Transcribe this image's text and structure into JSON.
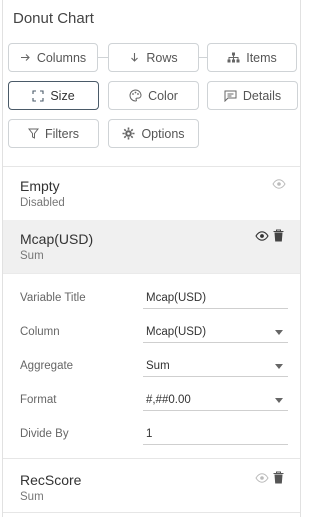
{
  "panel": {
    "title": "Donut Chart"
  },
  "tabs": {
    "columns": "Columns",
    "rows": "Rows",
    "items": "Items",
    "size": "Size",
    "color": "Color",
    "details": "Details",
    "filters": "Filters",
    "options": "Options"
  },
  "empty_section": {
    "name": "Empty",
    "status": "Disabled"
  },
  "selected_measure": {
    "name": "Mcap(USD)",
    "aggregate": "Sum"
  },
  "settings": {
    "variable_title_label": "Variable Title",
    "variable_title_value": "Mcap(USD)",
    "column_label": "Column",
    "column_value": "Mcap(USD)",
    "aggregate_label": "Aggregate",
    "aggregate_value": "Sum",
    "format_label": "Format",
    "format_value": "#,##0.00",
    "divide_by_label": "Divide By",
    "divide_by_value": "1"
  },
  "recscore": {
    "name": "RecScore",
    "aggregate": "Sum"
  },
  "colors": {
    "accent_border": "#4a5a68",
    "border": "#cfd3d6",
    "selected_bg": "#f0f0f0"
  },
  "icons": [
    "arrow-right-icon",
    "arrow-down-icon",
    "hierarchy-icon",
    "size-icon",
    "palette-icon",
    "comment-icon",
    "filter-icon",
    "gear-icon",
    "eye-icon",
    "trash-icon",
    "chevron-down-icon"
  ]
}
